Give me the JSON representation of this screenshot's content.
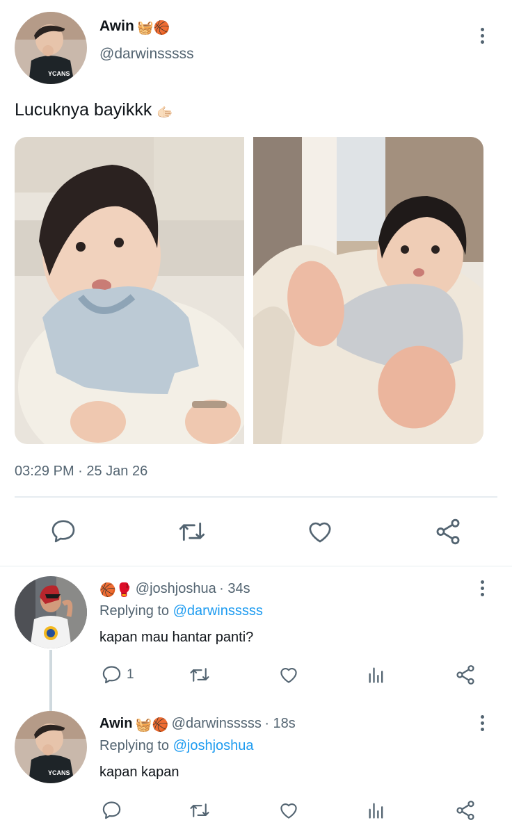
{
  "main_tweet": {
    "author_name": "Awin",
    "author_emojis": "🧺🏀",
    "author_handle": "@darwinsssss",
    "text": "Lucuknya bayikkk",
    "text_emoji": "🫱🏻",
    "timestamp": "03:29 PM · 25 Jan 26",
    "photos": [
      {
        "alt": "baby sitting on cushion"
      },
      {
        "alt": "baby lying with feet raised"
      }
    ],
    "actions": [
      "reply-icon",
      "retweet-icon",
      "like-icon",
      "share-icon"
    ]
  },
  "replies": [
    {
      "emojis": "🏀🥊",
      "handle": "@joshjoshua",
      "time": "· 34s",
      "replying_prefix": "Replying to ",
      "replying_to": "@darwinsssss",
      "text": "kapan mau hantar panti?",
      "reply_count": "1"
    },
    {
      "author_name": "Awin",
      "emojis": "🧺🏀",
      "handle": "@darwinsssss",
      "time": "· 18s",
      "replying_prefix": "Replying to ",
      "replying_to": "@joshjoshua",
      "text": "kapan kapan"
    }
  ],
  "colors": {
    "accent": "#1d9bf0",
    "secondary_text": "#536471",
    "divider": "#e6ecf0"
  }
}
